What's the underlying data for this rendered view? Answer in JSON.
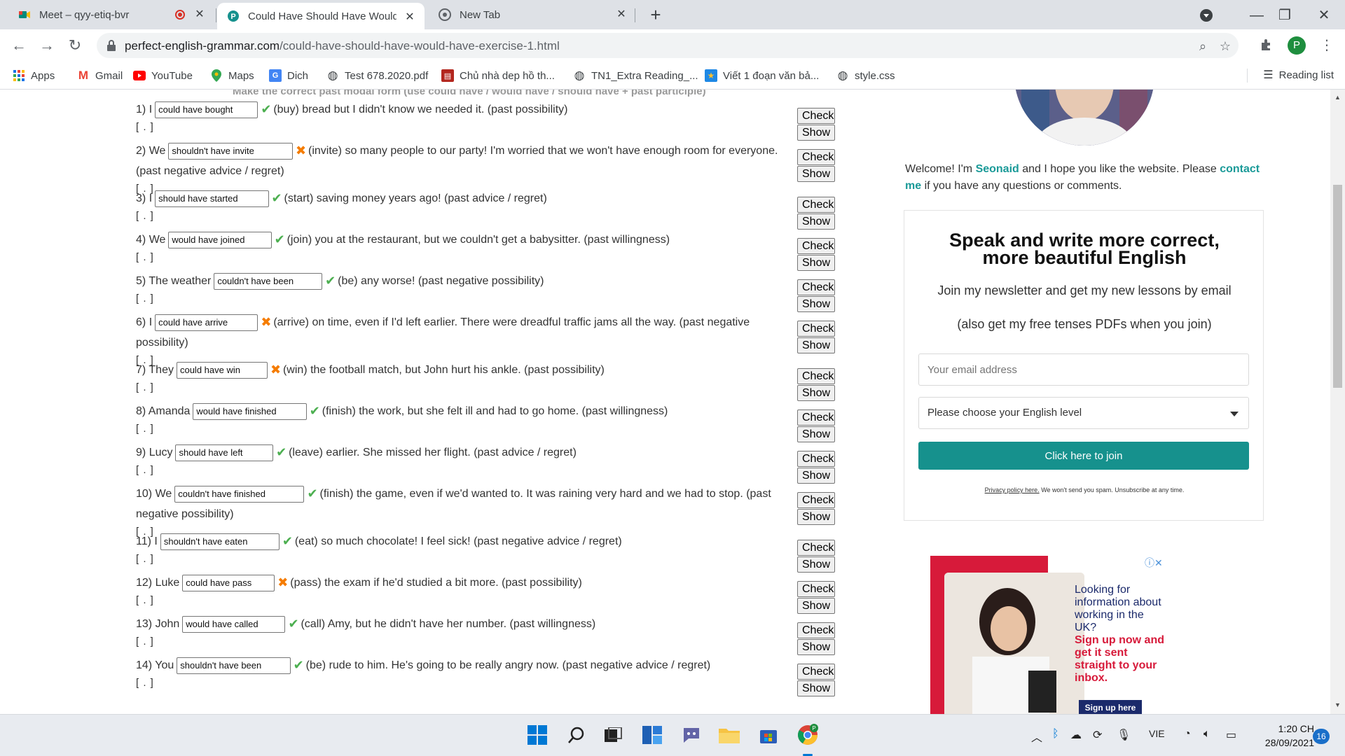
{
  "browser": {
    "tabs": [
      {
        "title": "Meet – qyy-etiq-bvr",
        "recording": true
      },
      {
        "title": "Could Have Should Have Would",
        "active": true
      },
      {
        "title": "New Tab"
      }
    ],
    "url_domain": "perfect-english-grammar.com",
    "url_path": "/could-have-should-have-would-have-exercise-1.html",
    "profile_initial": "P",
    "bookmarks": [
      {
        "label": "Apps",
        "icon": "apps-grid-icon"
      },
      {
        "label": "Gmail",
        "icon": "gmail-icon"
      },
      {
        "label": "YouTube",
        "icon": "youtube-icon"
      },
      {
        "label": "Maps",
        "icon": "maps-icon"
      },
      {
        "label": "Dich",
        "icon": "translate-icon"
      },
      {
        "label": "Test 678.2020.pdf",
        "icon": "globe-icon"
      },
      {
        "label": "Chủ nhà dep hồ th...",
        "icon": "bookmark-icon"
      },
      {
        "label": "TN1_Extra Reading_...",
        "icon": "globe-icon"
      },
      {
        "label": "Viết 1 đoạn văn bả...",
        "icon": "bookmark-icon"
      },
      {
        "label": "style.css",
        "icon": "globe-icon"
      }
    ],
    "reading_list": "Reading list"
  },
  "exercise": {
    "instruction": "Make the correct past modal form (use could have / would have / should have + past participle)",
    "brackets": "[ . ]",
    "check_label": "Check",
    "show_label": "Show",
    "questions": [
      {
        "num": "1)",
        "pre": "I",
        "answer": "could have bought",
        "status": "correct",
        "post": "(buy) bread but I didn't know we needed it. (past possibility)",
        "post2": ""
      },
      {
        "num": "2)",
        "pre": "We",
        "answer": "shouldn't have invite",
        "status": "wrong",
        "post": "(invite) so many people to our party! I'm worried that we won't have enough room for everyone.",
        "post2": "(past negative advice / regret)"
      },
      {
        "num": "3)",
        "pre": "I",
        "answer": "should have started",
        "status": "correct",
        "post": "(start) saving money years ago! (past advice / regret)",
        "post2": ""
      },
      {
        "num": "4)",
        "pre": "We",
        "answer": "would have joined",
        "status": "correct",
        "post": "(join) you at the restaurant, but we couldn't get a babysitter. (past willingness)",
        "post2": ""
      },
      {
        "num": "5)",
        "pre": "The weather",
        "answer": "couldn't have been",
        "status": "correct",
        "post": "(be) any worse! (past negative possibility)",
        "post2": ""
      },
      {
        "num": "6)",
        "pre": "I",
        "answer": "could have arrive",
        "status": "wrong",
        "post": "(arrive) on time, even if I'd left earlier. There were dreadful traffic jams all the way. (past negative",
        "post2": "possibility)"
      },
      {
        "num": "7)",
        "pre": "They",
        "answer": "could have win",
        "status": "wrong",
        "post": "(win) the football match, but John hurt his ankle. (past possibility)",
        "post2": ""
      },
      {
        "num": "8)",
        "pre": "Amanda",
        "answer": "would have finished",
        "status": "correct",
        "post": "(finish) the work, but she felt ill and had to go home. (past willingness)",
        "post2": ""
      },
      {
        "num": "9)",
        "pre": "Lucy",
        "answer": "should have left",
        "status": "correct",
        "post": "(leave) earlier. She missed her flight. (past advice / regret)",
        "post2": ""
      },
      {
        "num": "10)",
        "pre": "We",
        "answer": "couldn't have finished",
        "status": "correct",
        "post": "(finish) the game, even if we'd wanted to. It was raining very hard and we had to stop. (past",
        "post2": "negative possibility)"
      },
      {
        "num": "11)",
        "pre": "I",
        "answer": "shouldn't have eaten",
        "status": "correct",
        "post": "(eat) so much chocolate! I feel sick! (past negative advice / regret)",
        "post2": ""
      },
      {
        "num": "12)",
        "pre": "Luke",
        "answer": "could have pass",
        "status": "wrong",
        "post": "(pass) the exam if he'd studied a bit more. (past possibility)",
        "post2": ""
      },
      {
        "num": "13)",
        "pre": "John",
        "answer": "would have called",
        "status": "correct",
        "post": "(call) Amy, but he didn't have her number. (past willingness)",
        "post2": ""
      },
      {
        "num": "14)",
        "pre": "You",
        "answer": "shouldn't have been",
        "status": "correct",
        "post": "(be) rude to him. He's going to be really angry now. (past negative advice / regret)",
        "post2": ""
      }
    ]
  },
  "sidebar": {
    "welcome_pre": "Welcome! I'm",
    "name": "Seonaid",
    "welcome_mid": "and I hope you like the website. Please",
    "contact": "contact me",
    "welcome_post": "if you have any questions or comments.",
    "newsletter": {
      "title_line1": "Speak and write more correct,",
      "title_line2": "more beautiful English",
      "subtitle": "Join my newsletter and get my new lessons by email",
      "subtitle2": "(also get my free tenses PDFs when you join)",
      "email_placeholder": "Your email address",
      "level_placeholder": "Please choose your English level",
      "join_button": "Click here to join",
      "privacy_link": "Privacy policy here.",
      "privacy_text": "We won't send you spam. Unsubscribe at any time."
    },
    "ad": {
      "line1": "Looking for information about working in the UK?",
      "line2": "Sign up now and get it sent straight to your inbox.",
      "button": "Sign up here"
    }
  },
  "taskbar": {
    "language": "VIE",
    "time": "1:20 CH",
    "date": "28/09/2021",
    "notifications": "16"
  },
  "colors": {
    "accent": "#16918d",
    "correct": "#4caf50",
    "wrong": "#f57c00",
    "chrome_bg": "#dee1e6"
  }
}
